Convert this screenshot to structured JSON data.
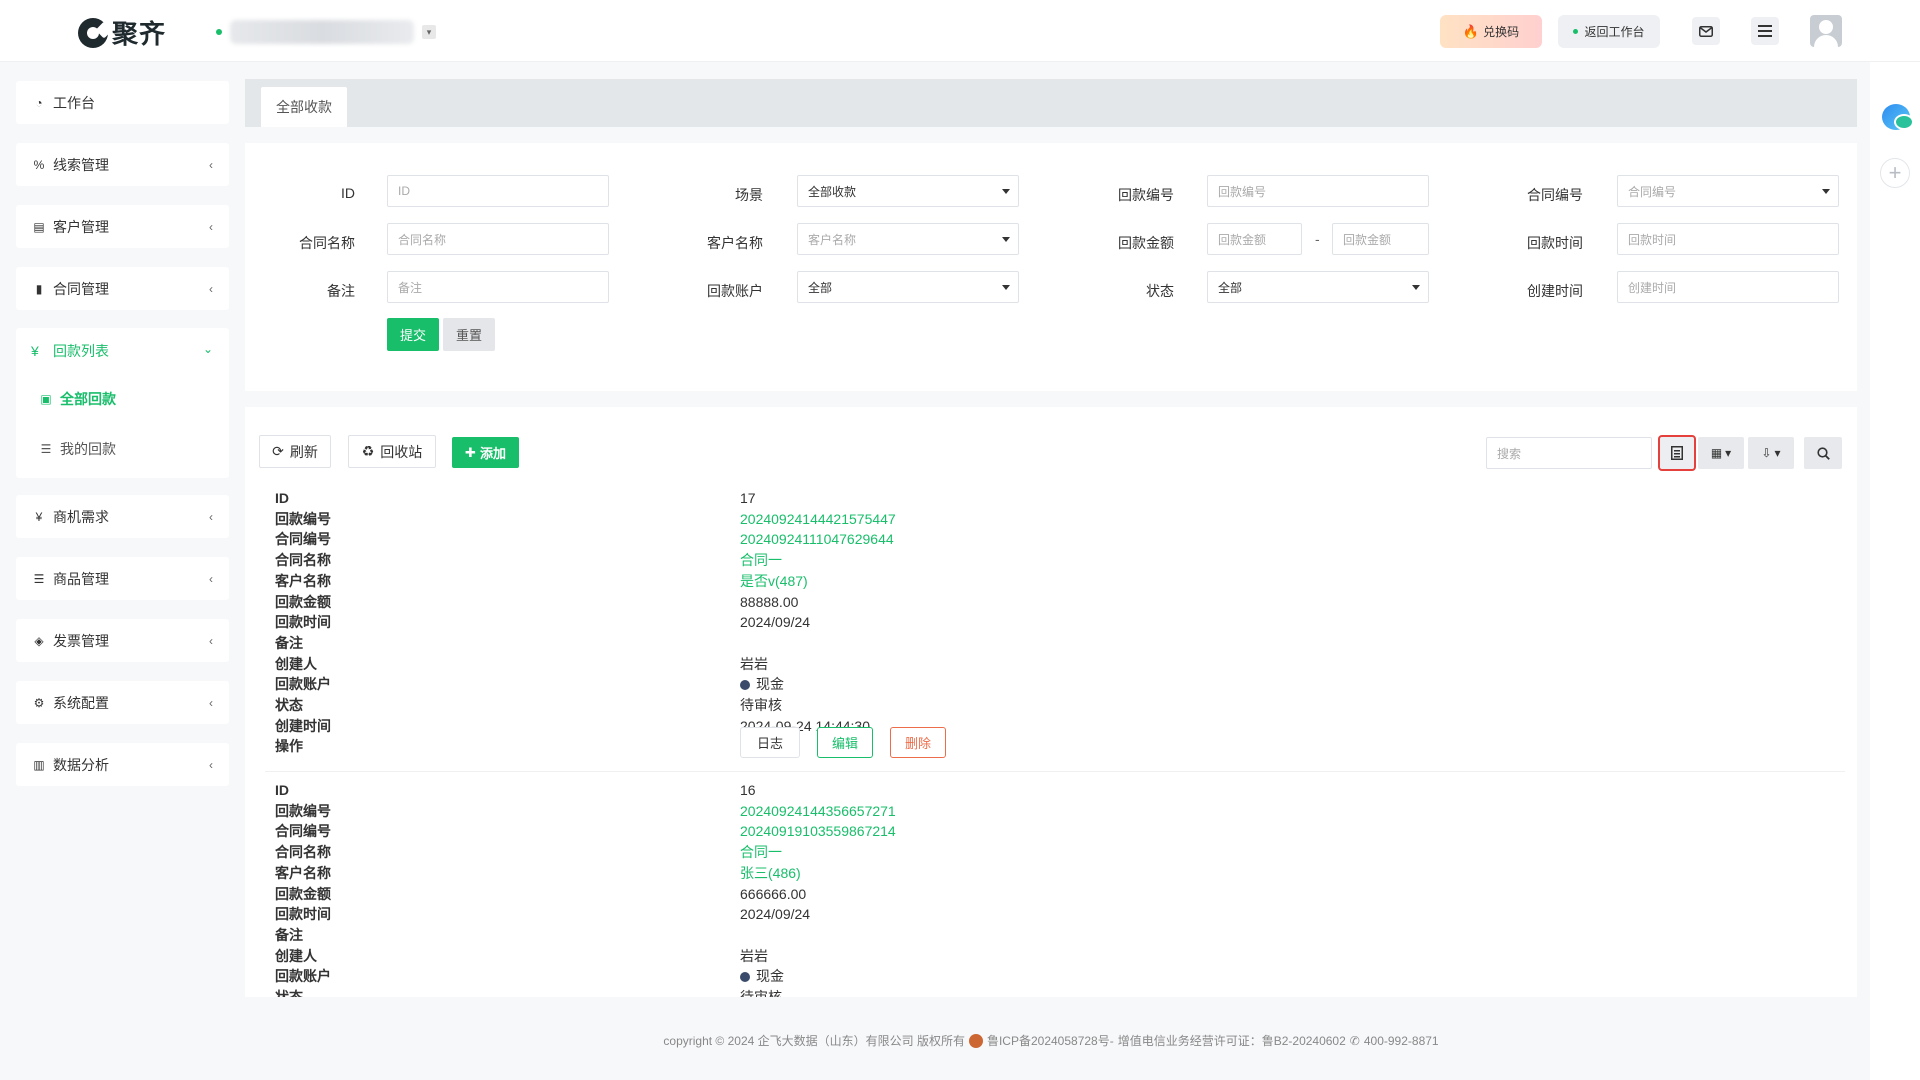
{
  "brand": {
    "name": "聚齐"
  },
  "header": {
    "redeem_label": "兑换码",
    "back_label": "返回工作台"
  },
  "sidebar": {
    "items": [
      {
        "label": "工作台",
        "icon": "dashboard-icon"
      },
      {
        "label": "线索管理",
        "icon": "link-icon"
      },
      {
        "label": "客户管理",
        "icon": "id-card-icon"
      },
      {
        "label": "合同管理",
        "icon": "bookmark-icon"
      }
    ],
    "group": {
      "label": "回款列表",
      "icon": "yen-icon",
      "subs": [
        {
          "label": "全部回款",
          "icon": "money-icon"
        },
        {
          "label": "我的回款",
          "icon": "list-icon"
        }
      ]
    },
    "items2": [
      {
        "label": "商机需求",
        "icon": "yen-icon"
      },
      {
        "label": "商品管理",
        "icon": "list-icon"
      },
      {
        "label": "发票管理",
        "icon": "tag-icon"
      },
      {
        "label": "系统配置",
        "icon": "cogs-icon"
      },
      {
        "label": "数据分析",
        "icon": "bar-chart-icon"
      }
    ]
  },
  "tabs": {
    "active": "全部收款"
  },
  "filters": {
    "id": {
      "label": "ID",
      "placeholder": "ID"
    },
    "scene": {
      "label": "场景",
      "value": "全部收款"
    },
    "payment_no": {
      "label": "回款编号",
      "placeholder": "回款编号"
    },
    "contract_no": {
      "label": "合同编号",
      "placeholder": "合同编号"
    },
    "contract_name": {
      "label": "合同名称",
      "placeholder": "合同名称"
    },
    "customer_name": {
      "label": "客户名称",
      "placeholder": "客户名称"
    },
    "amount": {
      "label": "回款金额",
      "placeholder_min": "回款金额",
      "placeholder_max": "回款金额",
      "separator": "-"
    },
    "payment_time": {
      "label": "回款时间",
      "placeholder": "回款时间"
    },
    "remark": {
      "label": "备注",
      "placeholder": "备注"
    },
    "account": {
      "label": "回款账户",
      "value": "全部"
    },
    "status": {
      "label": "状态",
      "value": "全部"
    },
    "created_time": {
      "label": "创建时间",
      "placeholder": "创建时间"
    },
    "submit_label": "提交",
    "reset_label": "重置"
  },
  "toolbar": {
    "refresh_label": "刷新",
    "recycle_label": "回收站",
    "add_label": "添加",
    "search_placeholder": "搜索"
  },
  "field_labels": [
    "ID",
    "回款编号",
    "合同编号",
    "合同名称",
    "客户名称",
    "回款金额",
    "回款时间",
    "备注",
    "创建人",
    "回款账户",
    "状态",
    "创建时间",
    "操作"
  ],
  "records": [
    {
      "id": "17",
      "payment_no": "20240924144421575447",
      "contract_no": "20240924111047629644",
      "contract_name": "合同一",
      "customer_name": "是否v(487)",
      "amount": "88888.00",
      "payment_time": "2024/09/24",
      "remark": "",
      "creator": "岩岩",
      "account": "现金",
      "status": "待审核",
      "created_time": "2024-09-24 14:44:30",
      "actions": {
        "log": "日志",
        "edit": "编辑",
        "delete": "删除"
      }
    },
    {
      "id": "16",
      "payment_no": "20240924144356657271",
      "contract_no": "20240919103559867214",
      "contract_name": "合同一",
      "customer_name": "张三(486)",
      "amount": "666666.00",
      "payment_time": "2024/09/24",
      "remark": "",
      "creator": "岩岩",
      "account": "现金",
      "status": "待审核"
    }
  ],
  "footer": {
    "copyright": "copyright © 2024 企飞大数据（山东）有限公司 版权所有",
    "icp": "鲁ICP备2024058728号-",
    "license": "增值电信业务经营许可证：鲁B2-20240602",
    "phone": "400-992-8871"
  },
  "colors": {
    "accent": "#19be6b",
    "danger": "#ed6d4a",
    "highlight": "#e5403c"
  }
}
